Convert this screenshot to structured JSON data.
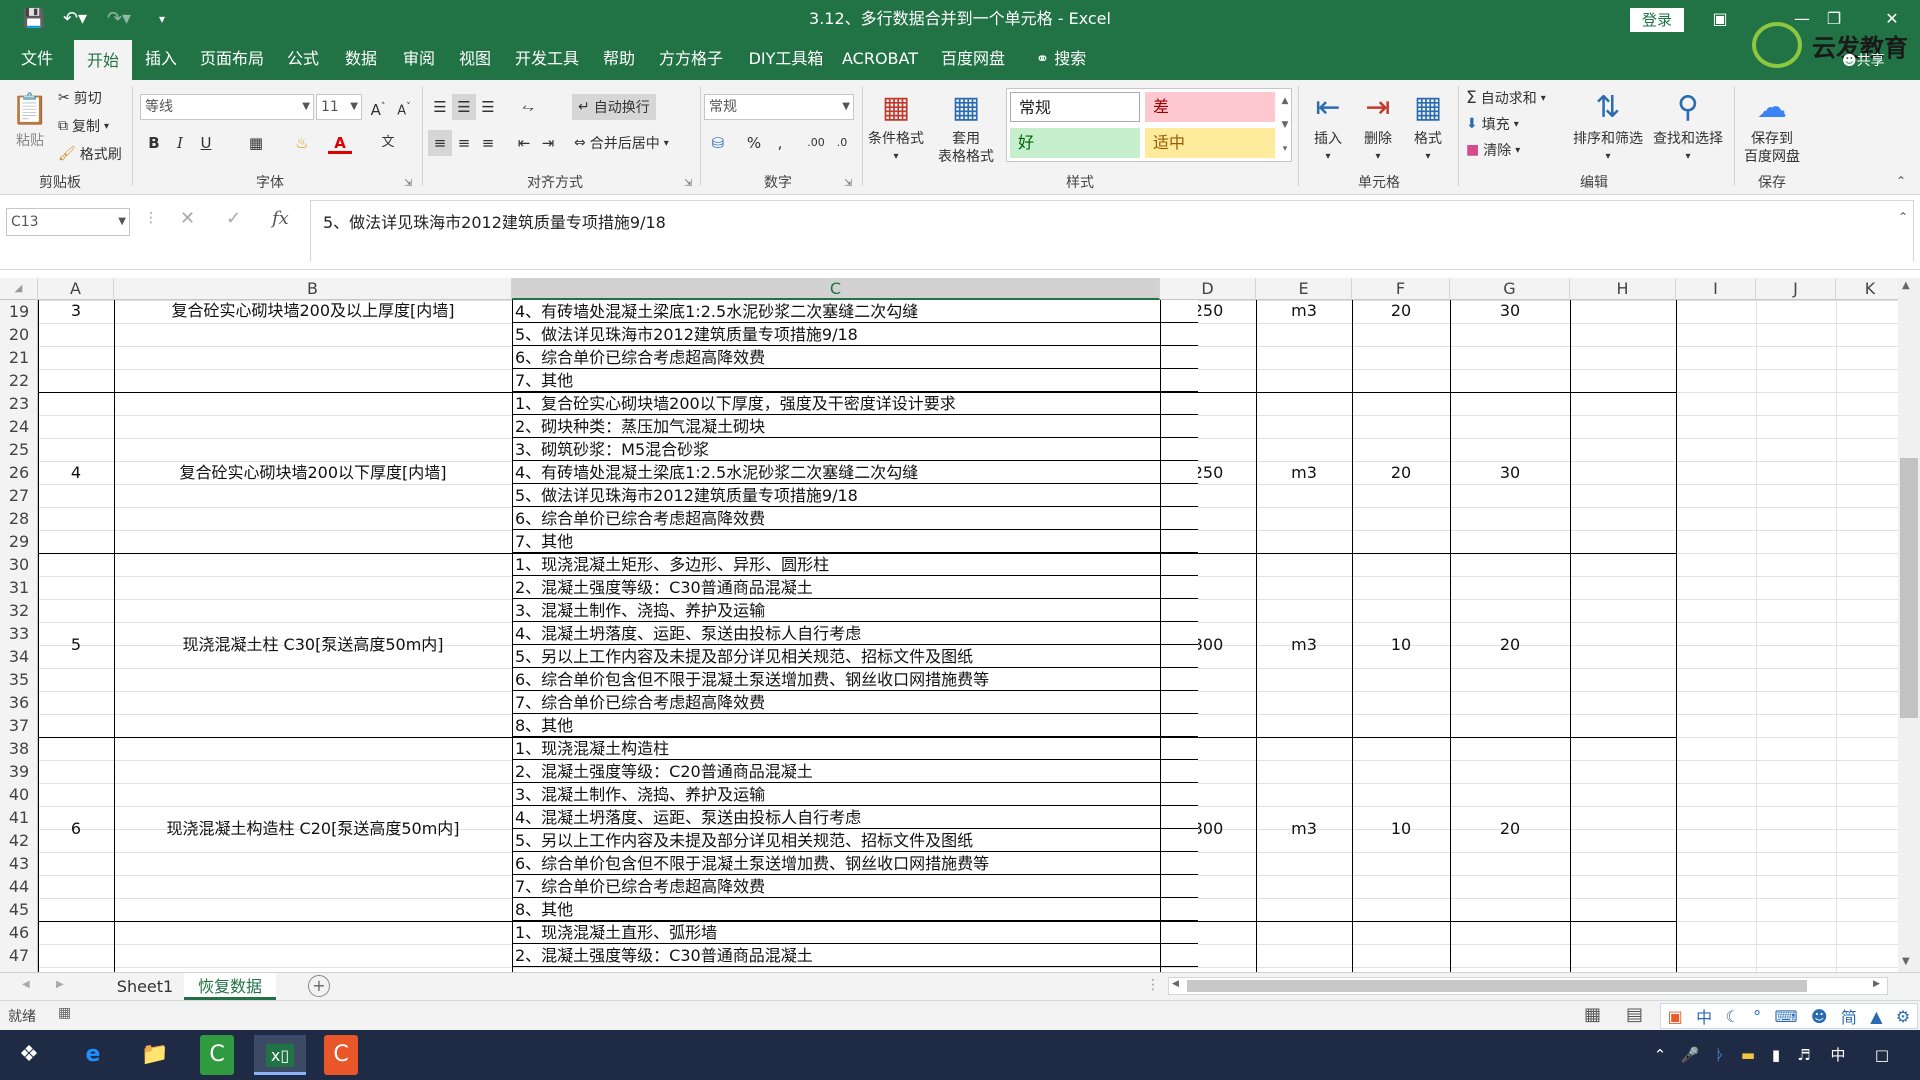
{
  "window": {
    "title": "3.12、多行数据合并到一个单元格 - Excel",
    "login_label": "登录",
    "watermark_text": "云发教育",
    "share_label": "共享"
  },
  "qat": {
    "save_icon": "save-icon",
    "undo_icon": "undo-icon",
    "redo_icon": "redo-icon",
    "customize_icon": "customize-icon"
  },
  "tabs": [
    "文件",
    "开始",
    "插入",
    "页面布局",
    "公式",
    "数据",
    "审阅",
    "视图",
    "开发工具",
    "帮助",
    "方方格子",
    "DIY工具箱",
    "ACROBAT",
    "百度网盘"
  ],
  "active_tab": "开始",
  "search_label": "搜索",
  "ribbon": {
    "clipboard": {
      "paste": "粘贴",
      "cut": "剪切",
      "copy": "复制",
      "format_painter": "格式刷",
      "label": "剪贴板"
    },
    "font": {
      "name": "等线",
      "size": "11",
      "label": "字体",
      "bold": "B",
      "italic": "I",
      "underline": "U",
      "grow": "A",
      "shrink": "A",
      "font_color_icon": "A"
    },
    "alignment": {
      "wrap": "自动换行",
      "merge": "合并后居中",
      "label": "对齐方式"
    },
    "number": {
      "format": "常规",
      "percent": "%",
      "comma": ",",
      "label": "数字"
    },
    "styles": {
      "conditional": "条件格式",
      "table_line1": "套用",
      "table_line2": "表格格式",
      "normal": "常规",
      "bad": "差",
      "good": "好",
      "neutral": "适中",
      "label": "样式",
      "bad_color": "#ffc7ce",
      "good_color": "#c6efce",
      "neutral_color": "#ffeb9c"
    },
    "cells": {
      "insert": "插入",
      "delete": "删除",
      "format": "格式",
      "label": "单元格"
    },
    "editing": {
      "autosum": "自动求和",
      "fill": "填充",
      "clear": "清除",
      "sort": "排序和筛选",
      "find": "查找和选择",
      "label": "编辑"
    },
    "save": {
      "line1": "保存到",
      "line2": "百度网盘",
      "label": "保存"
    }
  },
  "formula_bar": {
    "name_box": "C13",
    "fx": "fx",
    "content": "5、做法详见珠海市2012建筑质量专项措施9/18"
  },
  "columns": [
    "A",
    "B",
    "C",
    "D",
    "E",
    "F",
    "G",
    "H",
    "I",
    "J",
    "K"
  ],
  "selected_column": "C",
  "rows": {
    "numbers": [
      "19",
      "20",
      "21",
      "22",
      "23",
      "24",
      "25",
      "26",
      "27",
      "28",
      "29",
      "30",
      "31",
      "32",
      "33",
      "34",
      "35",
      "36",
      "37",
      "38",
      "39",
      "40",
      "41",
      "42",
      "43",
      "44",
      "45",
      "46",
      "47"
    ],
    "c_values": [
      "4、有砖墙处混凝土梁底1:2.5水泥砂浆二次塞缝二次勾缝",
      "5、做法详见珠海市2012建筑质量专项措施9/18",
      "6、综合单价已综合考虑超高降效费",
      "7、其他",
      "1、复合砼实心砌块墙200以下厚度，强度及干密度详设计要求",
      "2、砌块种类：蒸压加气混凝土砌块",
      "3、砌筑砂浆：M5混合砂浆",
      "4、有砖墙处混凝土梁底1:2.5水泥砂浆二次塞缝二次勾缝",
      "5、做法详见珠海市2012建筑质量专项措施9/18",
      "6、综合单价已综合考虑超高降效费",
      "7、其他",
      "1、现浇混凝土矩形、多边形、异形、圆形柱",
      "2、混凝土强度等级：C30普通商品混凝土",
      "3、混凝土制作、浇捣、养护及运输",
      "4、混凝土坍落度、运距、泵送由投标人自行考虑",
      "5、另以上工作内容及未提及部分详见相关规范、招标文件及图纸",
      "6、综合单价包含但不限于混凝土泵送增加费、钢丝收口网措施费等",
      "7、综合单价已综合考虑超高降效费",
      "8、其他",
      "1、现浇混凝土构造柱",
      "2、混凝土强度等级：C20普通商品混凝土",
      "3、混凝土制作、浇捣、养护及运输",
      "4、混凝土坍落度、运距、泵送由投标人自行考虑",
      "5、另以上工作内容及未提及部分详见相关规范、招标文件及图纸",
      "6、综合单价包含但不限于混凝土泵送增加费、钢丝收口网措施费等",
      "7、综合单价已综合考虑超高降效费",
      "8、其他",
      "1、现浇混凝土直形、弧形墙",
      "2、混凝土强度等级：C30普通商品混凝土"
    ]
  },
  "items": [
    {
      "no": "3",
      "name": "复合砼实心砌块墙200及以上厚度[内墙]",
      "d": "250",
      "e": "m3",
      "f": "20",
      "g": "30"
    },
    {
      "no": "4",
      "name": "复合砼实心砌块墙200以下厚度[内墙]",
      "d": "250",
      "e": "m3",
      "f": "20",
      "g": "30"
    },
    {
      "no": "5",
      "name": "现浇混凝土柱 C30[泵送高度50m内]",
      "d": "300",
      "e": "m3",
      "f": "10",
      "g": "20"
    },
    {
      "no": "6",
      "name": "现浇混凝土构造柱 C20[泵送高度50m内]",
      "d": "300",
      "e": "m3",
      "f": "10",
      "g": "20"
    }
  ],
  "sheets": [
    "Sheet1",
    "恢复数据"
  ],
  "active_sheet": "恢复数据",
  "status": {
    "ready": "就绪"
  },
  "ime": {
    "lang": "中",
    "simplified": "简"
  },
  "taskbar": {
    "tray_lang": "中"
  }
}
